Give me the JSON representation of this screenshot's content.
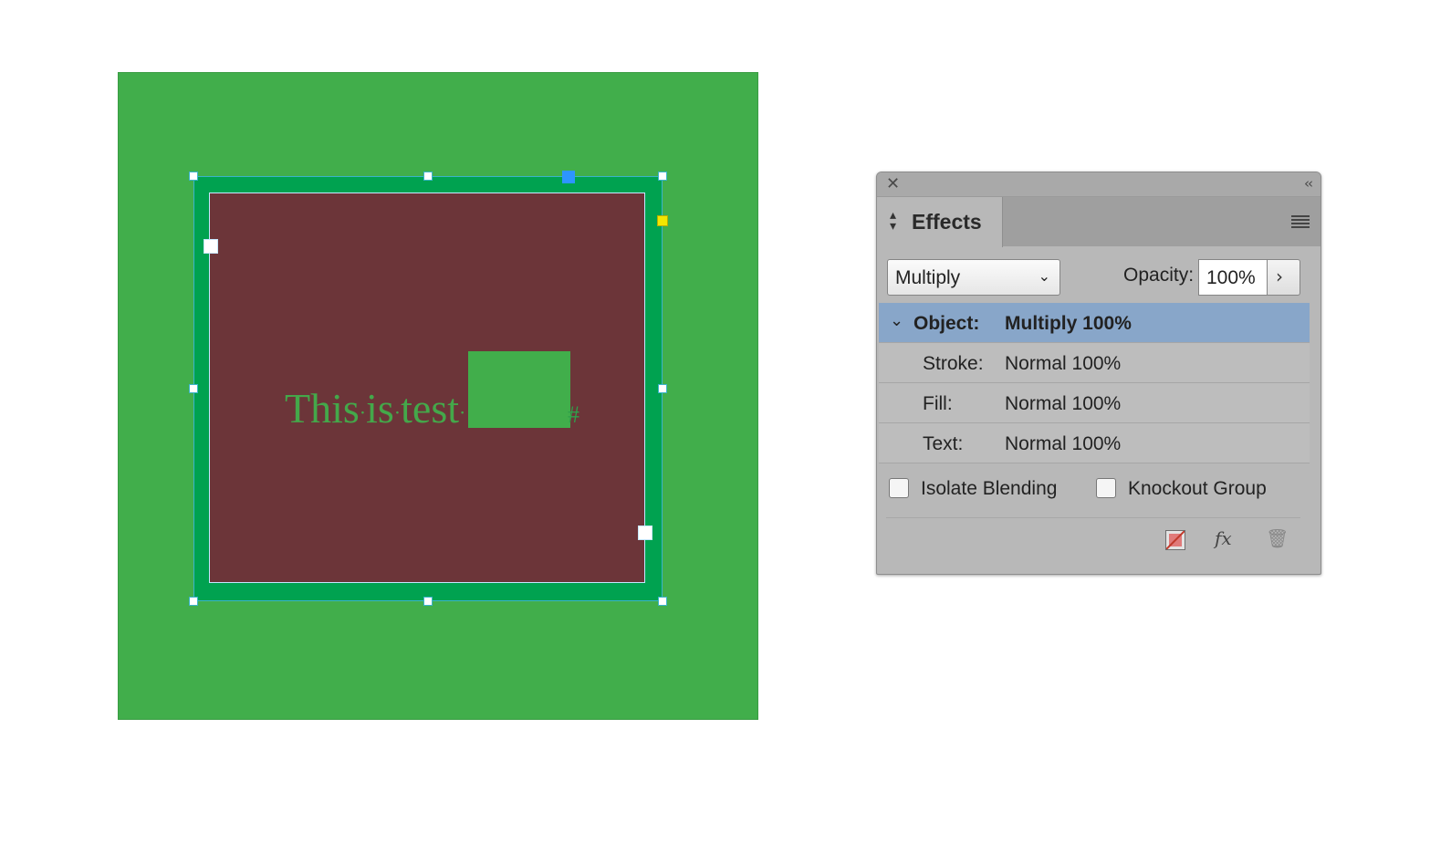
{
  "canvas": {
    "text_words": [
      "This",
      "is",
      "test"
    ],
    "end_marker": "#",
    "colors": {
      "page_background": "#41ae4b",
      "frame_stroke": "#00a250",
      "frame_fill": "#6c3539",
      "text": "#44a84a",
      "inline_rectangle": "#41ae4b"
    },
    "handle_colors": {
      "default": "#ffffff",
      "anchor": "#2d95ff",
      "corner_option": "#f2e600"
    }
  },
  "panel": {
    "close_icon": "close-icon",
    "collapse_icon": "collapse-icon",
    "tab_label": "Effects",
    "blend_mode": "Multiply",
    "opacity_label": "Opacity:",
    "opacity_value": "100%",
    "rows": [
      {
        "label": "Object:",
        "value": "Multiply 100%",
        "selected": true
      },
      {
        "label": "Stroke:",
        "value": "Normal 100%",
        "selected": false
      },
      {
        "label": "Fill:",
        "value": "Normal 100%",
        "selected": false
      },
      {
        "label": "Text:",
        "value": "Normal 100%",
        "selected": false
      }
    ],
    "checkboxes": [
      {
        "label": "Isolate Blending",
        "checked": false
      },
      {
        "label": "Knockout Group",
        "checked": false
      }
    ],
    "fx_label": "fx",
    "colors": {
      "panel_background": "#b8b8b8",
      "selected_row": "#88a6c9"
    }
  }
}
